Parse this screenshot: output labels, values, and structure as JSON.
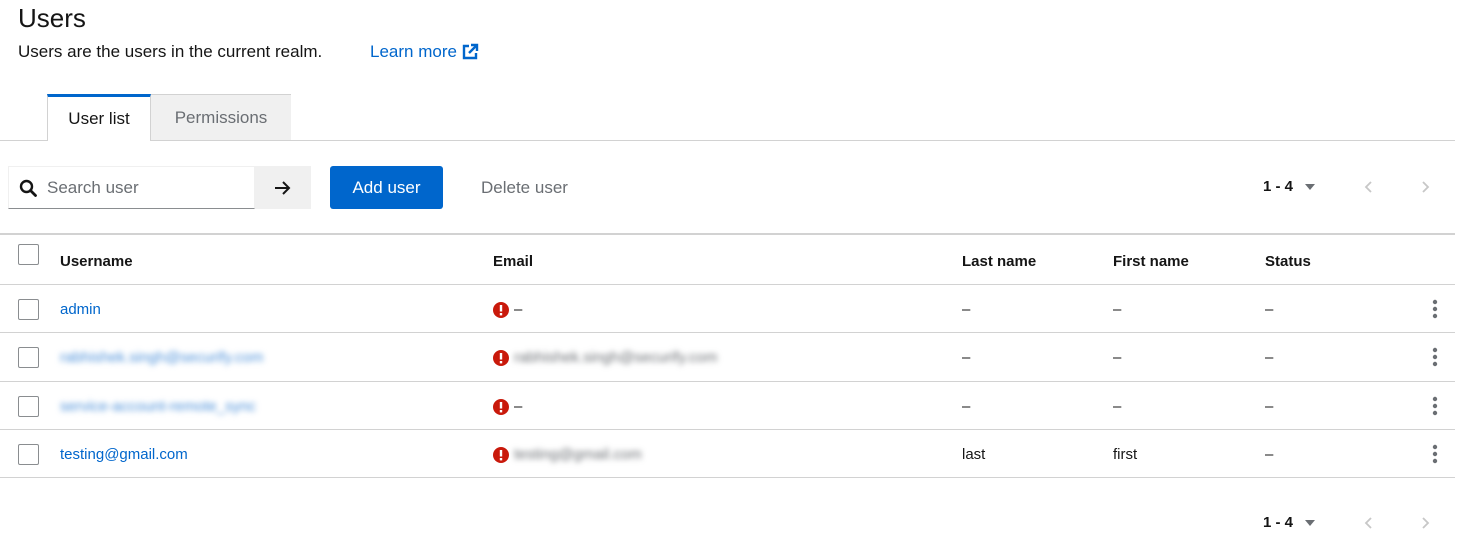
{
  "page": {
    "title": "Users",
    "description": "Users are the users in the current realm.",
    "learn_more": "Learn more"
  },
  "tabs": [
    {
      "label": "User list",
      "active": true
    },
    {
      "label": "Permissions",
      "active": false
    }
  ],
  "toolbar": {
    "search_placeholder": "Search user",
    "add_user": "Add user",
    "delete_user": "Delete user"
  },
  "pagination": {
    "top": "1 - 4",
    "bottom": "1 - 4"
  },
  "table": {
    "headers": [
      "Username",
      "Email",
      "Last name",
      "First name",
      "Status"
    ],
    "rows": [
      {
        "username": "admin",
        "email": "–",
        "email_blurred": false,
        "username_blurred": false,
        "last_name": "–",
        "first_name": "–",
        "status": "–"
      },
      {
        "username": "rabhishek.singh@securify.com",
        "email": "rabhishek.singh@securify.com",
        "email_blurred": true,
        "username_blurred": true,
        "last_name": "–",
        "first_name": "–",
        "status": "–"
      },
      {
        "username": "service-account-remote_sync",
        "email": "–",
        "email_blurred": false,
        "username_blurred": true,
        "last_name": "–",
        "first_name": "–",
        "status": "–"
      },
      {
        "username": "testing@gmail.com",
        "email": "testing@gmail.com",
        "email_blurred": true,
        "username_blurred": false,
        "last_name": "last",
        "first_name": "first",
        "status": "–"
      }
    ]
  },
  "colors": {
    "accent": "#0066cc",
    "error": "#c9190b",
    "border": "#d2d2d2"
  },
  "icons": {
    "external_link": "external-link-icon",
    "search": "search-icon",
    "arrow_right": "arrow-right-icon",
    "caret": "caret-down-icon",
    "prev": "chevron-left-icon",
    "next": "chevron-right-icon",
    "error": "exclamation-circle-icon",
    "kebab": "kebab-icon"
  }
}
